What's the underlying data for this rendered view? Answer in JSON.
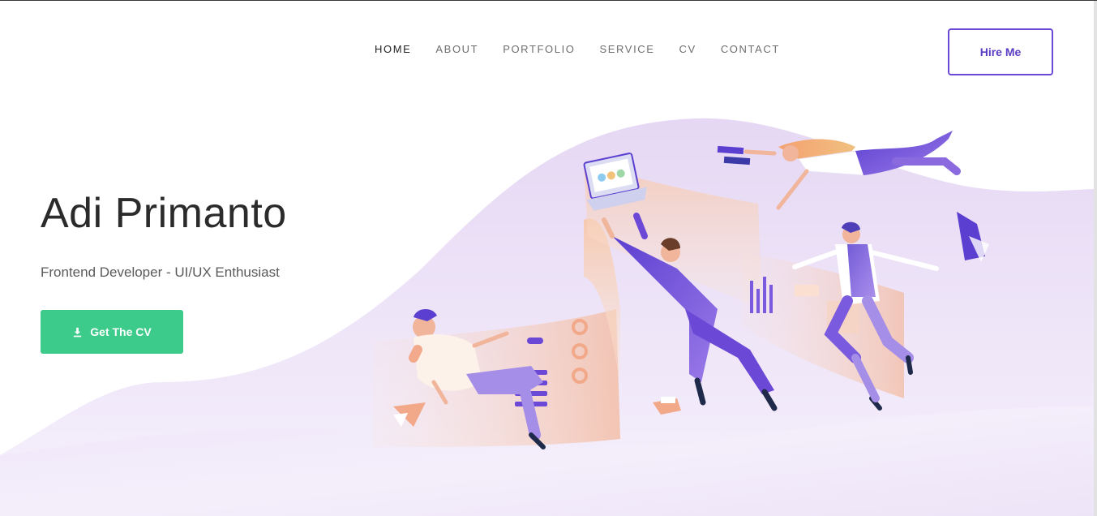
{
  "nav": {
    "items": [
      {
        "label": "HOME",
        "active": true
      },
      {
        "label": "ABOUT",
        "active": false
      },
      {
        "label": "PORTFOLIO",
        "active": false
      },
      {
        "label": "SERVICE",
        "active": false
      },
      {
        "label": "CV",
        "active": false
      },
      {
        "label": "CONTACT",
        "active": false
      }
    ],
    "hire_label": "Hire Me"
  },
  "hero": {
    "name": "Adi Primanto",
    "subtitle": "Frontend Developer - UI/UX Enthusiast",
    "cv_button_label": "Get The CV",
    "cv_button_icon": "download-icon"
  },
  "illustration": {
    "icon": "team-collaboration-illustration"
  },
  "colors": {
    "accent": "#6b48d6",
    "cv_button": "#3ccb8a",
    "wave": "#ede3f7",
    "text_dark": "#2b2b2b"
  }
}
